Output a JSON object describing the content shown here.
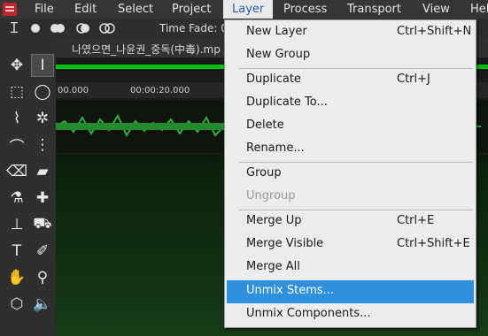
{
  "menubar": {
    "items": [
      {
        "label": "File"
      },
      {
        "label": "Edit"
      },
      {
        "label": "Select"
      },
      {
        "label": "Project"
      },
      {
        "label": "Layer"
      },
      {
        "label": "Process"
      },
      {
        "label": "Transport"
      },
      {
        "label": "View"
      },
      {
        "label": "Hel"
      }
    ]
  },
  "toolbar": {
    "time_fade_label": "Time Fade: 0."
  },
  "track": {
    "filename": "나였으면_나윤권_중독(中毒).mp",
    "ruler": [
      "00.000",
      "00:00:20.000"
    ]
  },
  "layer_menu": {
    "items": [
      {
        "label": "New Layer",
        "shortcut": "Ctrl+Shift+N"
      },
      {
        "label": "New Group",
        "shortcut": ""
      },
      {
        "label": "Duplicate",
        "shortcut": "Ctrl+J"
      },
      {
        "label": "Duplicate To...",
        "shortcut": ""
      },
      {
        "label": "Delete",
        "shortcut": ""
      },
      {
        "label": "Rename...",
        "shortcut": ""
      },
      {
        "label": "Group",
        "shortcut": ""
      },
      {
        "label": "Ungroup",
        "shortcut": ""
      },
      {
        "label": "Merge Up",
        "shortcut": "Ctrl+E"
      },
      {
        "label": "Merge Visible",
        "shortcut": "Ctrl+Shift+E"
      },
      {
        "label": "Merge All",
        "shortcut": ""
      },
      {
        "label": "Unmix Stems...",
        "shortcut": ""
      },
      {
        "label": "Unmix Components...",
        "shortcut": ""
      }
    ]
  },
  "colors": {
    "highlight": "#2f90e0",
    "accent_green": "#00c000"
  }
}
